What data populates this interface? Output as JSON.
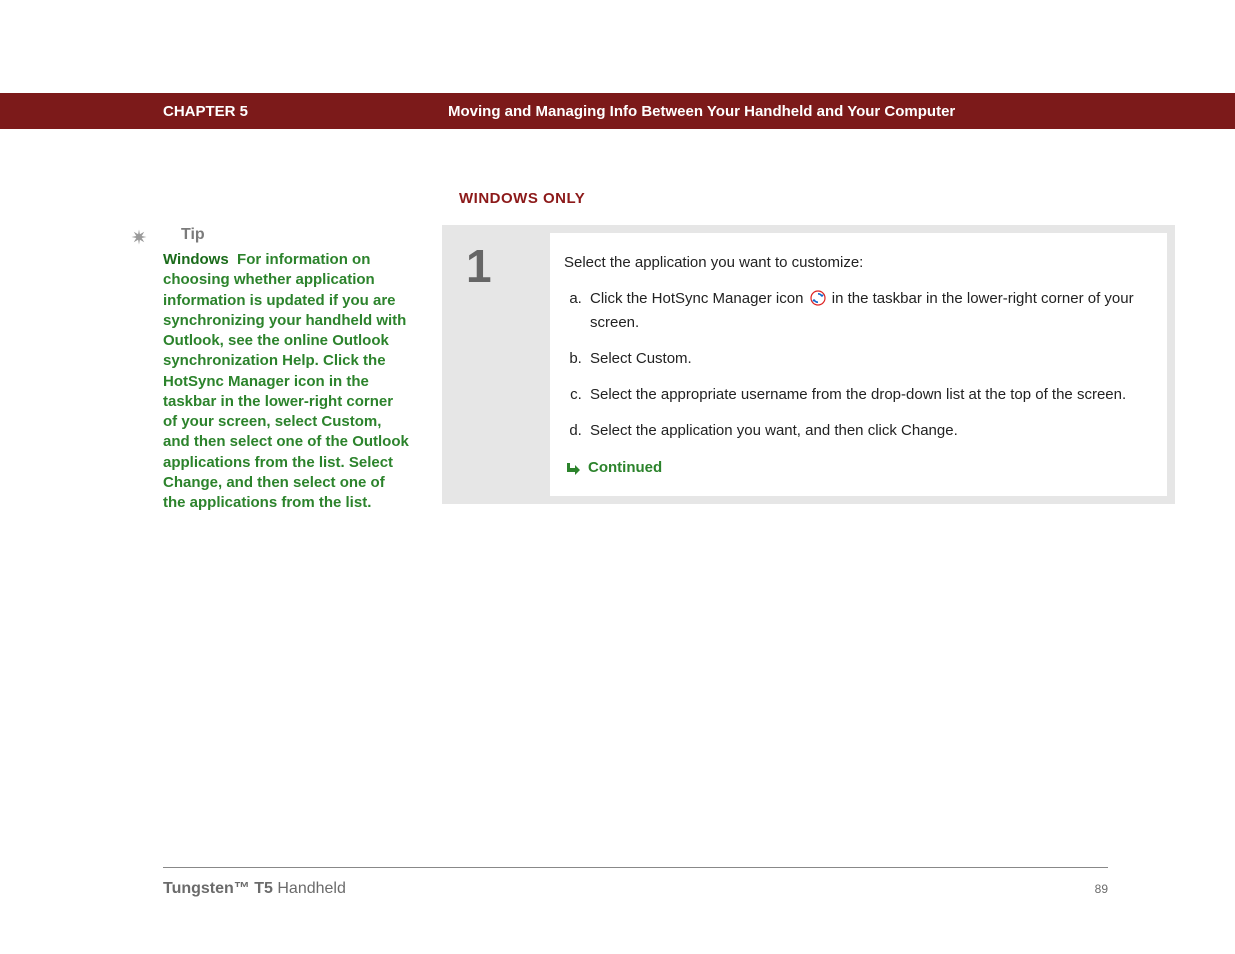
{
  "header": {
    "chapter": "CHAPTER 5",
    "title": "Moving and Managing Info Between Your Handheld and Your Computer"
  },
  "section_heading": "WINDOWS ONLY",
  "sidebar": {
    "tip_label": "Tip",
    "tip_platform": "Windows",
    "tip_body": "For information on choosing whether application information is updated if you are synchronizing your handheld with Outlook, see the online Outlook synchronization Help. Click the HotSync Manager icon in the taskbar in the lower-right corner of your screen, select Custom, and then select one of the Outlook applications from the list. Select Change, and then select one of the applications from the list."
  },
  "step": {
    "number": "1",
    "intro": "Select the application you want to customize:",
    "items": {
      "a_pre": "Click the HotSync Manager icon ",
      "a_post": " in the taskbar in the lower-right corner of your screen.",
      "b": "Select Custom.",
      "c": "Select the appropriate username from the drop-down list at the top of the screen.",
      "d": "Select the application you want, and then click Change."
    },
    "continued": "Continued"
  },
  "footer": {
    "product_bold": "Tungsten™ T5",
    "product_rest": " Handheld",
    "page": "89"
  },
  "icons": {
    "asterisk": "asterisk-icon",
    "hotsync": "hotsync-icon",
    "continued_arrow": "arrow-down-right-icon"
  }
}
